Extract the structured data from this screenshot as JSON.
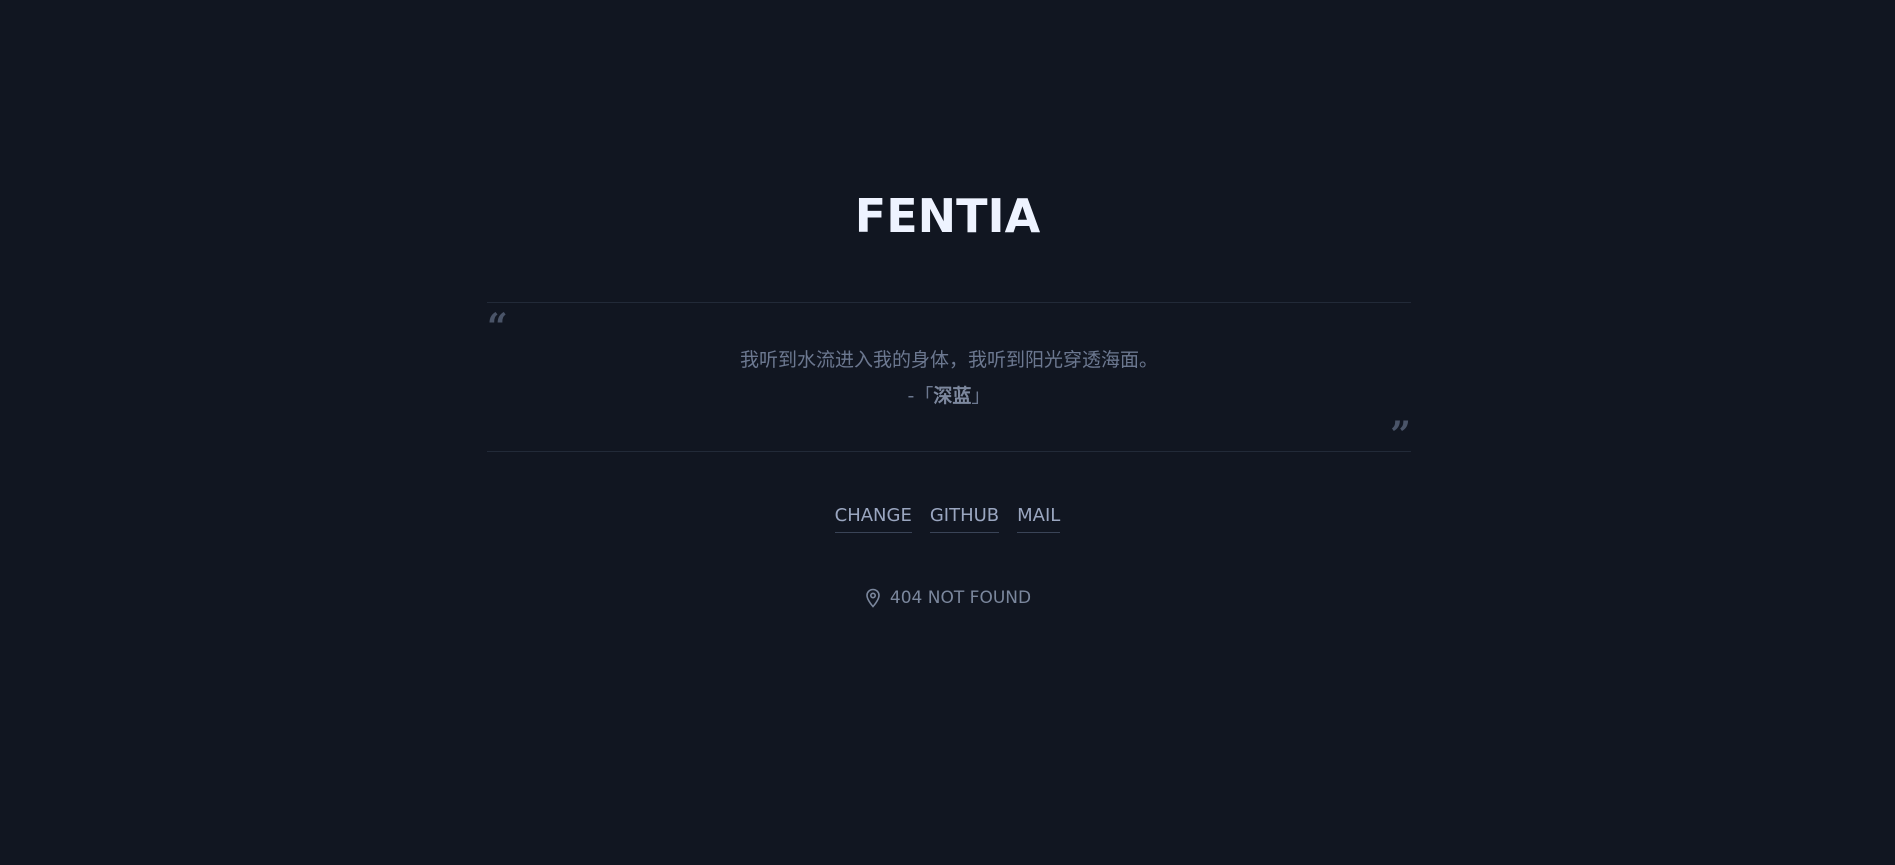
{
  "site": {
    "title": "FENTIA"
  },
  "quote": {
    "open_mark": "“",
    "close_mark": "”",
    "text": "我听到水流进入我的身体，我听到阳光穿透海面。",
    "author_prefix": "-「",
    "author": "深蓝",
    "author_suffix": "」"
  },
  "links": [
    {
      "label": "CHANGE"
    },
    {
      "label": "GITHUB"
    },
    {
      "label": "MAIL"
    }
  ],
  "status": {
    "icon": "map-pin-icon",
    "text": "404 NOT FOUND"
  },
  "colors": {
    "background": "#111621",
    "title": "#eef3ff",
    "text_muted": "#6c7890",
    "link": "#9aa6c0"
  }
}
